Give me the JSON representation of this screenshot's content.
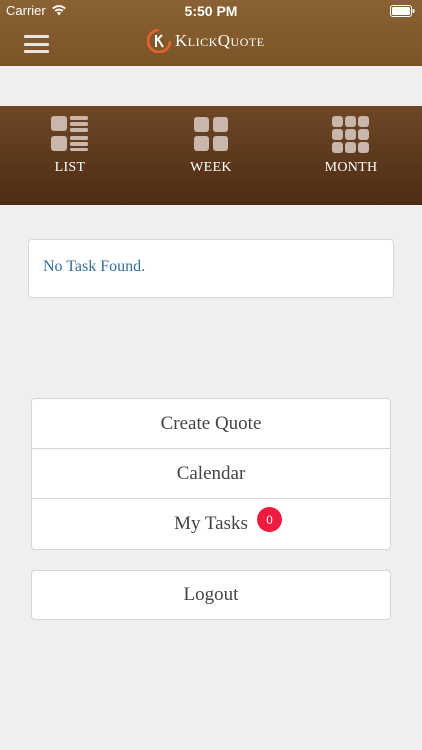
{
  "status_bar": {
    "carrier": "Carrier",
    "time": "5:50 PM"
  },
  "header": {
    "logo_text": "KlickQuote",
    "menu_icon": "hamburger-menu-icon",
    "brand_color": "#7e572a"
  },
  "view_bar": {
    "items": [
      {
        "label": "LIST",
        "icon": "list-view-icon"
      },
      {
        "label": "WEEK",
        "icon": "week-grid-icon"
      },
      {
        "label": "MONTH",
        "icon": "month-grid-icon"
      }
    ]
  },
  "tasks": {
    "empty_message": "No Task Found."
  },
  "actions": {
    "create_quote": "Create Quote",
    "calendar": "Calendar",
    "my_tasks": "My Tasks",
    "my_tasks_badge": "0",
    "logout": "Logout"
  },
  "colors": {
    "badge": "#ee1b3f",
    "message_text": "#336e95",
    "background": "#efeff1"
  }
}
